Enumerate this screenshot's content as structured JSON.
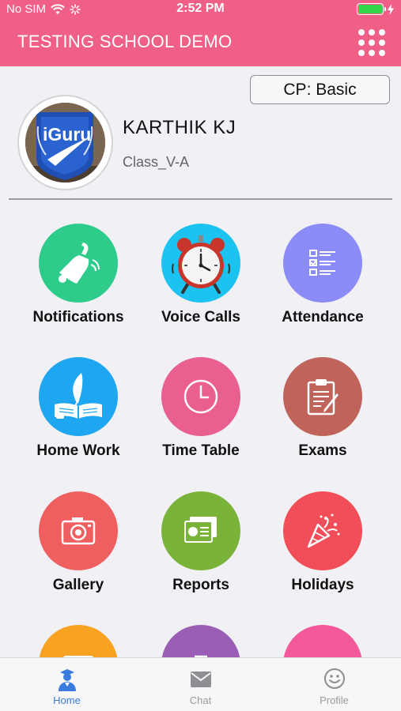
{
  "status_bar": {
    "carrier": "No SIM",
    "time": "2:52 PM"
  },
  "header": {
    "title": "TESTING SCHOOL DEMO",
    "menu_icon": "grid-menu-icon"
  },
  "profile": {
    "plan_button": "CP: Basic",
    "name": "KARTHIK KJ",
    "class": "Class_V-A",
    "avatar_logo_text": "iGuru"
  },
  "modules": [
    {
      "label": "Notifications",
      "icon": "bell-icon",
      "color": "#2ecc8a"
    },
    {
      "label": "Voice Calls",
      "icon": "alarm-clock-icon",
      "color": "#1cc2f0"
    },
    {
      "label": "Attendance",
      "icon": "checklist-icon",
      "color": "#8c8cf8"
    },
    {
      "label": "Home Work",
      "icon": "book-quill-icon",
      "color": "#1ea7f0"
    },
    {
      "label": "Time Table",
      "icon": "clock-icon",
      "color": "#e95f8f"
    },
    {
      "label": "Exams",
      "icon": "clipboard-icon",
      "color": "#c0635a"
    },
    {
      "label": "Gallery",
      "icon": "camera-icon",
      "color": "#ef5f5f"
    },
    {
      "label": "Reports",
      "icon": "report-icon",
      "color": "#7ab33a"
    },
    {
      "label": "Holidays",
      "icon": "party-popper-icon",
      "color": "#f24e5a"
    },
    {
      "label": "",
      "icon": "keyboard-icon",
      "color": "#f7a321"
    },
    {
      "label": "",
      "icon": "fee-icon",
      "color": "#9a5fb5"
    },
    {
      "label": "",
      "icon": "people-icon",
      "color": "#f2589a"
    }
  ],
  "tab_bar": {
    "home": "Home",
    "chat": "Chat",
    "profile": "Profile"
  },
  "colors": {
    "brand": "#ef5f86",
    "active_tab": "#3a7be0",
    "inactive_tab": "#9b9b9b"
  }
}
